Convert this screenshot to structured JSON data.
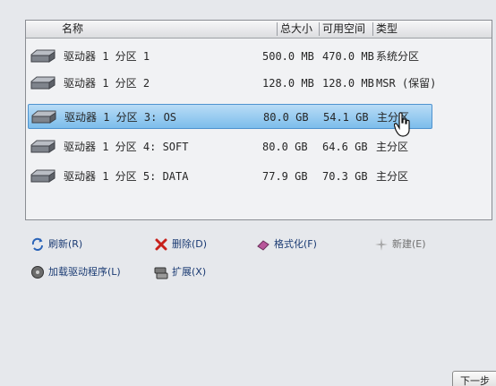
{
  "columns": {
    "name": "名称",
    "total": "总大小",
    "free": "可用空间",
    "type": "类型"
  },
  "partitions": [
    {
      "name": "驱动器 1 分区 1",
      "total": "500.0 MB",
      "free": "470.0 MB",
      "type": "系统分区",
      "selected": false
    },
    {
      "name": "驱动器 1 分区 2",
      "total": "128.0 MB",
      "free": "128.0 MB",
      "type": "MSR (保留)",
      "selected": false
    },
    {
      "name": "驱动器 1 分区 3: OS",
      "total": "80.0 GB",
      "free": "54.1 GB",
      "type": "主分区",
      "selected": true
    },
    {
      "name": "驱动器 1 分区 4: SOFT",
      "total": "80.0 GB",
      "free": "64.6 GB",
      "type": "主分区",
      "selected": false
    },
    {
      "name": "驱动器 1 分区 5: DATA",
      "total": "77.9 GB",
      "free": "70.3 GB",
      "type": "主分区",
      "selected": false
    }
  ],
  "actions": {
    "refresh": "刷新(R)",
    "delete": "删除(D)",
    "format": "格式化(F)",
    "new": "新建(E)",
    "load_driver": "加载驱动程序(L)",
    "extend": "扩展(X)"
  },
  "footer": {
    "next": "下一步"
  }
}
